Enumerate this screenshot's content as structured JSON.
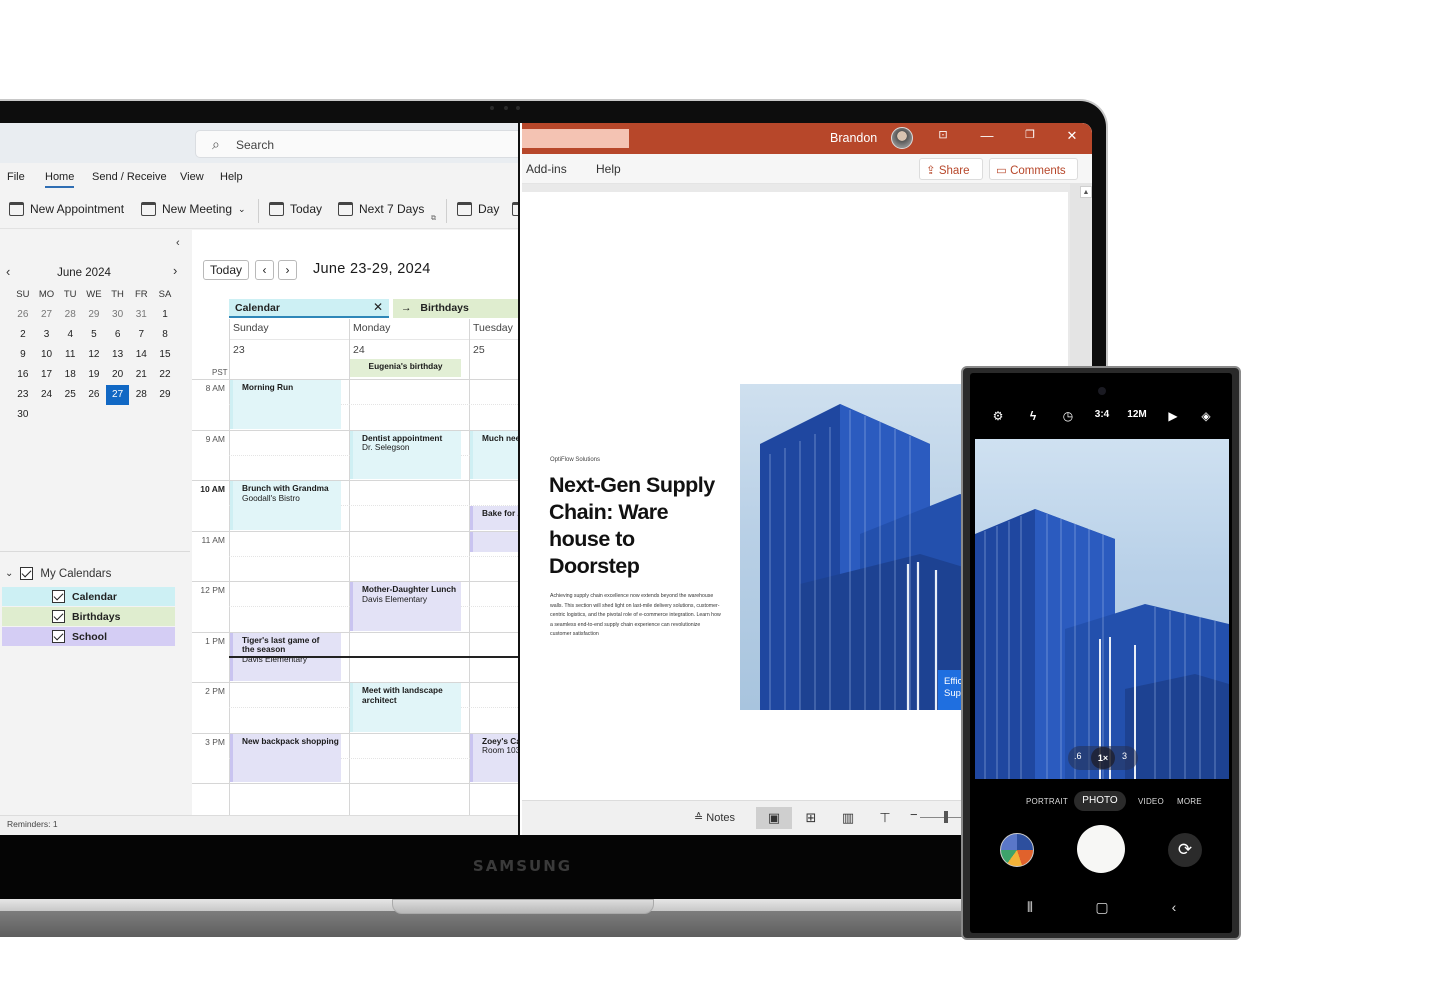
{
  "brand": {
    "laptop_logo": "SAMSUNG"
  },
  "outlook": {
    "search_placeholder": "Search",
    "menu": [
      "File",
      "Home",
      "Send / Receive",
      "View",
      "Help"
    ],
    "active_menu": "Home",
    "toolbar": {
      "new_appointment": "New Appointment",
      "new_meeting": "New Meeting",
      "today": "Today",
      "next_7_days": "Next 7 Days",
      "day": "Day"
    },
    "mini_calendar": {
      "title": "June 2024",
      "weekdays": [
        "SU",
        "MO",
        "TU",
        "WE",
        "TH",
        "FR",
        "SA"
      ],
      "days": [
        {
          "d": "26",
          "other": true
        },
        {
          "d": "27",
          "other": true
        },
        {
          "d": "28",
          "other": true
        },
        {
          "d": "29",
          "other": true
        },
        {
          "d": "30",
          "other": true
        },
        {
          "d": "31",
          "other": true
        },
        {
          "d": "1"
        },
        {
          "d": "2"
        },
        {
          "d": "3"
        },
        {
          "d": "4"
        },
        {
          "d": "5"
        },
        {
          "d": "6"
        },
        {
          "d": "7"
        },
        {
          "d": "8"
        },
        {
          "d": "9"
        },
        {
          "d": "10"
        },
        {
          "d": "11"
        },
        {
          "d": "12"
        },
        {
          "d": "13"
        },
        {
          "d": "14"
        },
        {
          "d": "15"
        },
        {
          "d": "16"
        },
        {
          "d": "17"
        },
        {
          "d": "18"
        },
        {
          "d": "19"
        },
        {
          "d": "20"
        },
        {
          "d": "21"
        },
        {
          "d": "22"
        },
        {
          "d": "23"
        },
        {
          "d": "24"
        },
        {
          "d": "25"
        },
        {
          "d": "26"
        },
        {
          "d": "27",
          "selected": true
        },
        {
          "d": "28"
        },
        {
          "d": "29"
        },
        {
          "d": "30"
        }
      ]
    },
    "my_calendars": {
      "label": "My Calendars",
      "items": [
        {
          "label": "Calendar",
          "color": "#cdf0f4",
          "checked": true
        },
        {
          "label": "Birthdays",
          "color": "#dfedcf",
          "checked": true
        },
        {
          "label": "School",
          "color": "#d4cdf4",
          "checked": true
        }
      ]
    },
    "week": {
      "today_button": "Today",
      "prev": "‹",
      "next": "›",
      "title": "June 23-29, 2024",
      "calendar_tab": "Calendar",
      "birthdays_tab": "Birthdays",
      "timezone": "PST",
      "days": [
        {
          "name": "Sunday",
          "num": "23"
        },
        {
          "name": "Monday",
          "num": "24"
        },
        {
          "name": "Tuesday",
          "num": "25"
        }
      ],
      "hours": [
        "8 AM",
        "9 AM",
        "10 AM",
        "11 AM",
        "12 PM",
        "1 PM",
        "2 PM",
        "3 PM"
      ],
      "current_hour": "10 AM",
      "all_day_events": [
        {
          "day": 1,
          "title": "Eugenia's birthday"
        }
      ],
      "events": [
        {
          "day": 0,
          "start": 0,
          "dur": 1,
          "type": "cal",
          "title": "Morning Run",
          "sub": ""
        },
        {
          "day": 1,
          "start": 1,
          "dur": 1,
          "type": "cal",
          "title": "Dentist appointment",
          "sub": "Dr. Selegson"
        },
        {
          "day": 2,
          "start": 1,
          "dur": 1,
          "type": "cal",
          "title": "Much needed",
          "sub": ""
        },
        {
          "day": 0,
          "start": 2,
          "dur": 1,
          "type": "cal",
          "title": "Brunch with Grandma",
          "sub": "Goodall's Bistro"
        },
        {
          "day": 2,
          "start": 2.5,
          "dur": 0.5,
          "type": "sch",
          "title": "Bake for Zoey",
          "sub": ""
        },
        {
          "day": 2,
          "start": 3,
          "dur": 0.45,
          "type": "sch",
          "title": "",
          "sub": ""
        },
        {
          "day": 1,
          "start": 4,
          "dur": 1,
          "type": "sch",
          "title": "Mother-Daughter Lunch",
          "sub": "Davis Elementary"
        },
        {
          "day": 0,
          "start": 5,
          "dur": 1,
          "type": "sch",
          "title": "Tiger's last game of",
          "title2": "the season",
          "sub": "Davis Elementary"
        },
        {
          "day": 1,
          "start": 6,
          "dur": 1,
          "type": "cal",
          "title": "Meet with landscape",
          "title2": "architect",
          "sub": ""
        },
        {
          "day": 0,
          "start": 7,
          "dur": 1,
          "type": "sch",
          "title": "New backpack shopping",
          "sub": ""
        },
        {
          "day": 2,
          "start": 7,
          "dur": 1,
          "type": "sch",
          "title": "Zoey's Cake",
          "sub": "Room 103"
        }
      ]
    },
    "status": "Reminders: 1"
  },
  "powerpoint": {
    "user_name": "Brandon",
    "ribbon": [
      "Add-ins",
      "Help"
    ],
    "share_label": "Share",
    "comments_label": "Comments",
    "slide": {
      "company": "OptiFlow Solutions",
      "title": "Next-Gen Supply Chain: Ware house to Doorstep",
      "body": "Achieving supply chain excellence now extends beyond the warehouse walls. This section will shed light on last-mile delivery solutions, customer-centric logistics, and the pivotal role of e-commerce integration. Learn how a seamless end-to-end supply chain experience can revolutionize customer satisfaction",
      "callout": "Effic\nSupp"
    },
    "status": {
      "notes_label": "Notes"
    },
    "accent": "#b7472a"
  },
  "phone_camera": {
    "top_controls": [
      "settings",
      "flash-off",
      "timer",
      "3:4",
      "12M",
      "motion-photo",
      "filters"
    ],
    "ratio": "3:4",
    "resolution": "12M",
    "zoom_options": [
      ".6",
      "1×",
      "3"
    ],
    "selected_zoom": "1×",
    "modes": [
      "PORTRAIT",
      "PHOTO",
      "VIDEO",
      "MORE"
    ],
    "selected_mode": "PHOTO"
  }
}
